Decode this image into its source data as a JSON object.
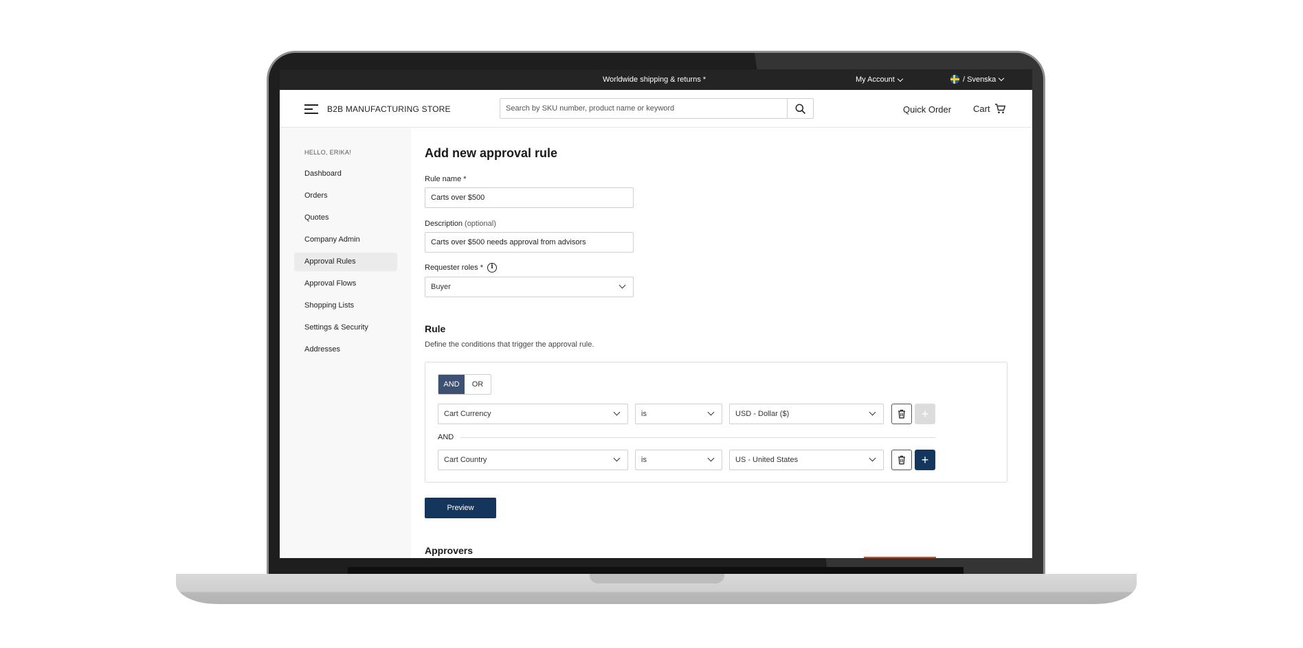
{
  "topbar": {
    "promo": "Worldwide shipping & returns *",
    "account_label": "My Account",
    "language_label": "/ Svenska"
  },
  "header": {
    "brand": "B2B MANUFACTURING STORE",
    "search_placeholder": "Search by SKU number, product name or keyword",
    "quick_order": "Quick Order",
    "cart": "Cart"
  },
  "sidebar": {
    "greeting": "HELLO, ERIKA!",
    "items": [
      {
        "label": "Dashboard"
      },
      {
        "label": "Orders"
      },
      {
        "label": "Quotes"
      },
      {
        "label": "Company Admin"
      },
      {
        "label": "Approval Rules",
        "active": true
      },
      {
        "label": "Approval Flows"
      },
      {
        "label": "Shopping Lists"
      },
      {
        "label": "Settings & Security"
      },
      {
        "label": "Addresses"
      }
    ]
  },
  "form": {
    "title": "Add new approval rule",
    "rule_name_label": "Rule name *",
    "rule_name_value": "Carts over $500",
    "description_label": "Description",
    "description_optional": "(optional)",
    "description_value": "Carts over $500 needs approval from advisors",
    "roles_label": "Requester roles *",
    "roles_value": "Buyer"
  },
  "rule": {
    "heading": "Rule",
    "description": "Define the conditions that trigger the approval rule.",
    "toggle": {
      "and": "AND",
      "or": "OR",
      "selected": "AND"
    },
    "separator": "AND",
    "conditions": [
      {
        "field": "Cart Currency",
        "operator": "is",
        "value": "USD - Dollar ($)",
        "add_enabled": false
      },
      {
        "field": "Cart Country",
        "operator": "is",
        "value": "US - United States",
        "add_enabled": true
      }
    ],
    "preview_button": "Preview"
  },
  "approvers": {
    "heading": "Approvers"
  },
  "colors": {
    "primary": "#15365c",
    "toggle_active": "#3d5272",
    "topbar": "#242424"
  }
}
